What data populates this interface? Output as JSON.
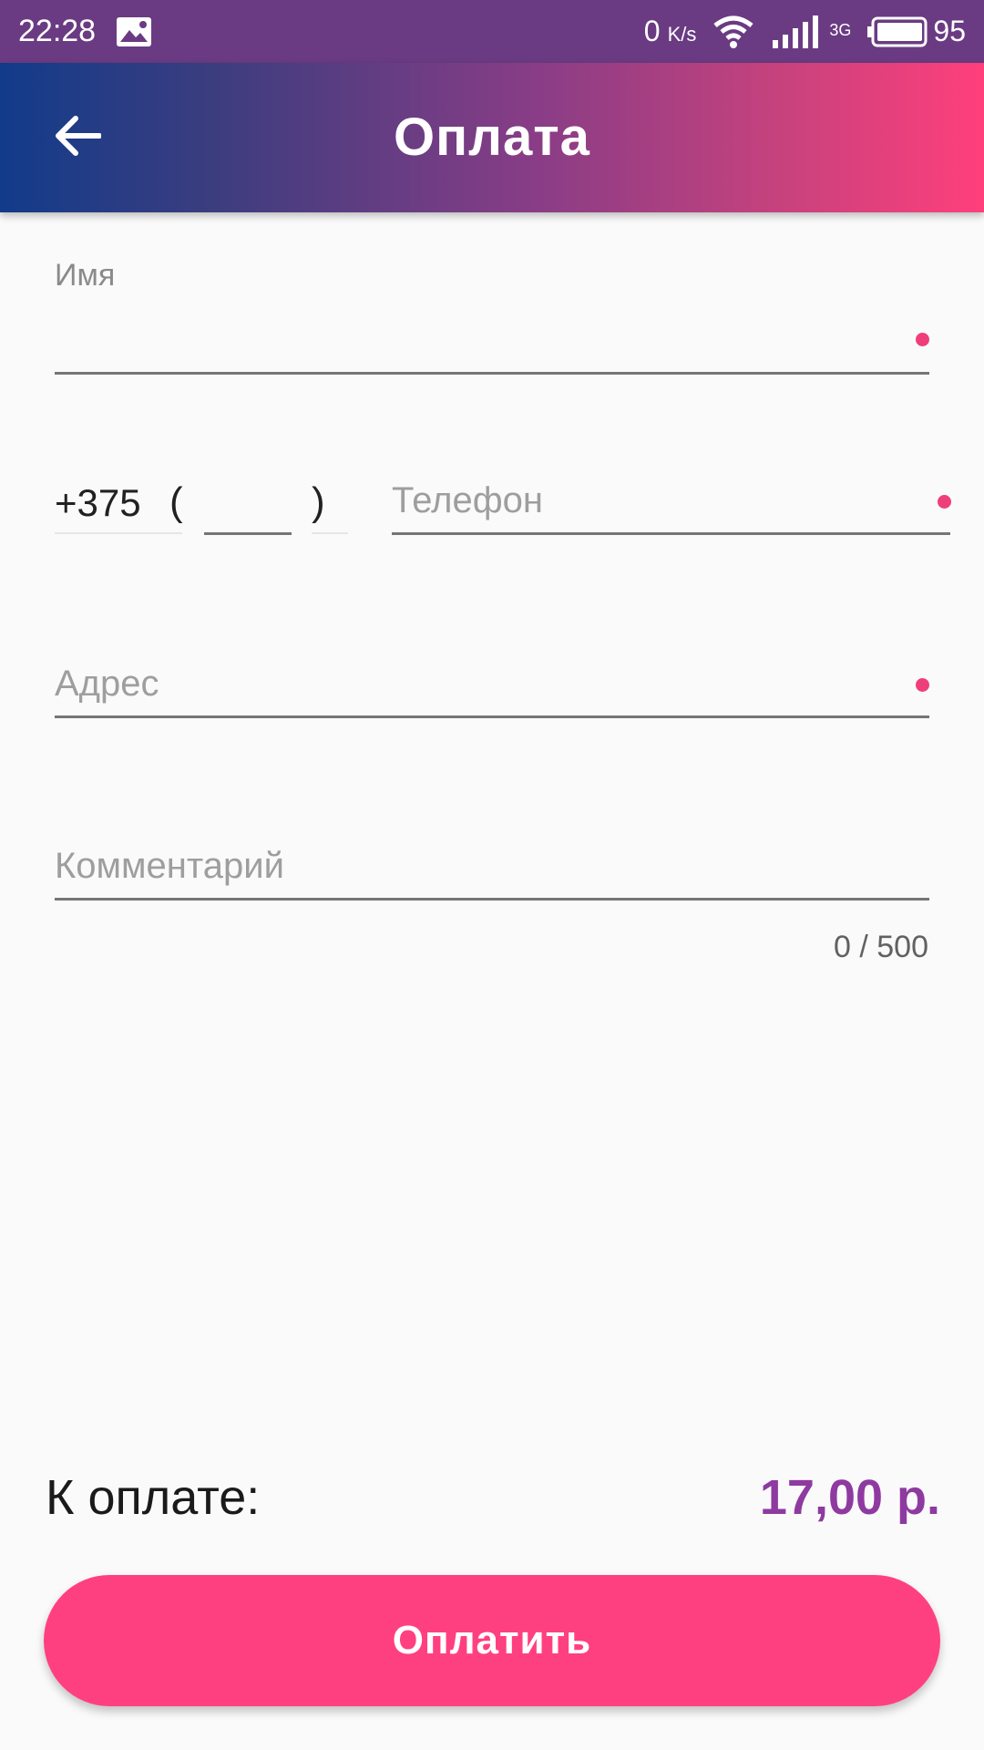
{
  "status_bar": {
    "time": "22:28",
    "speed_value": "0",
    "speed_unit": "K/s",
    "net_type": "3G",
    "battery": "95",
    "icons": [
      "gallery-icon",
      "wifi-icon",
      "signal-icon",
      "battery-icon"
    ]
  },
  "app_bar": {
    "title": "Оплата",
    "back_icon": "arrow-left-icon"
  },
  "form": {
    "name": {
      "label": "Имя",
      "value": ""
    },
    "phone": {
      "prefix": "+375",
      "open_paren": "(",
      "close_paren": ")",
      "code_value": "",
      "placeholder": "Телефон"
    },
    "address": {
      "placeholder": "Адрес"
    },
    "comment": {
      "placeholder": "Комментарий",
      "counter": "0 / 500"
    }
  },
  "total": {
    "label": "К оплате:",
    "amount": "17,00 р."
  },
  "pay_button": {
    "label": "Оплатить"
  },
  "colors": {
    "accent": "#ff4080",
    "price": "#8e3aa0",
    "required_dot": "#ef3f7b"
  }
}
